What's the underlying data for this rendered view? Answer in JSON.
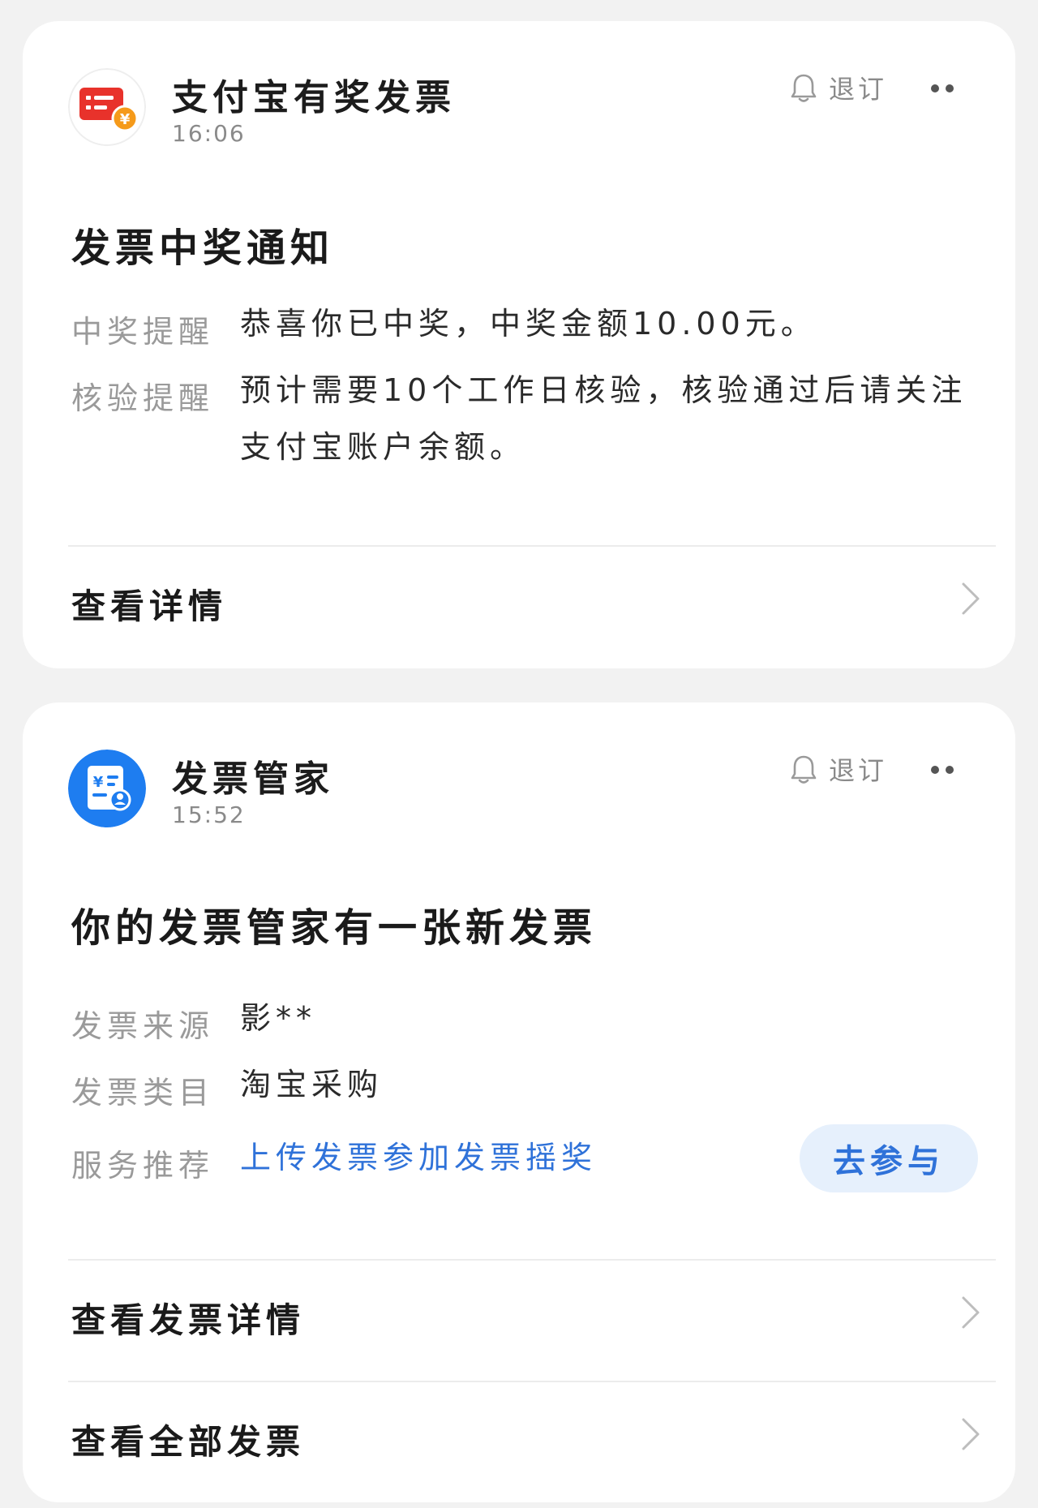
{
  "cards": [
    {
      "sender": {
        "name": "支付宝有奖发票",
        "time": "16:06",
        "icon": "red-invoice-lottery-icon"
      },
      "unsubscribe_label": "退订",
      "title": "发票中奖通知",
      "fields": [
        {
          "label": "中奖提醒",
          "value": "恭喜你已中奖，中奖金额10.00元。"
        },
        {
          "label": "核验提醒",
          "value_line1": "预计需要10个工作日核验，核验通过后请关注",
          "value_line2": "支付宝账户余额。"
        }
      ],
      "links": [
        {
          "label": "查看详情"
        }
      ]
    },
    {
      "sender": {
        "name": "发票管家",
        "time": "15:52",
        "icon": "blue-invoice-manager-icon"
      },
      "unsubscribe_label": "退订",
      "title": "你的发票管家有一张新发票",
      "fields": [
        {
          "label": "发票来源",
          "value": "影**"
        },
        {
          "label": "发票类目",
          "value": "淘宝采购"
        },
        {
          "label": "服务推荐",
          "value": "上传发票参加发票摇奖",
          "button": "去参与"
        }
      ],
      "links": [
        {
          "label": "查看发票详情"
        },
        {
          "label": "查看全部发票"
        }
      ]
    }
  ],
  "colors": {
    "link_blue": "#2f72d9",
    "button_bg": "#e6f0fc",
    "red_icon": "#e8322b",
    "blue_icon": "#1e7df0"
  }
}
